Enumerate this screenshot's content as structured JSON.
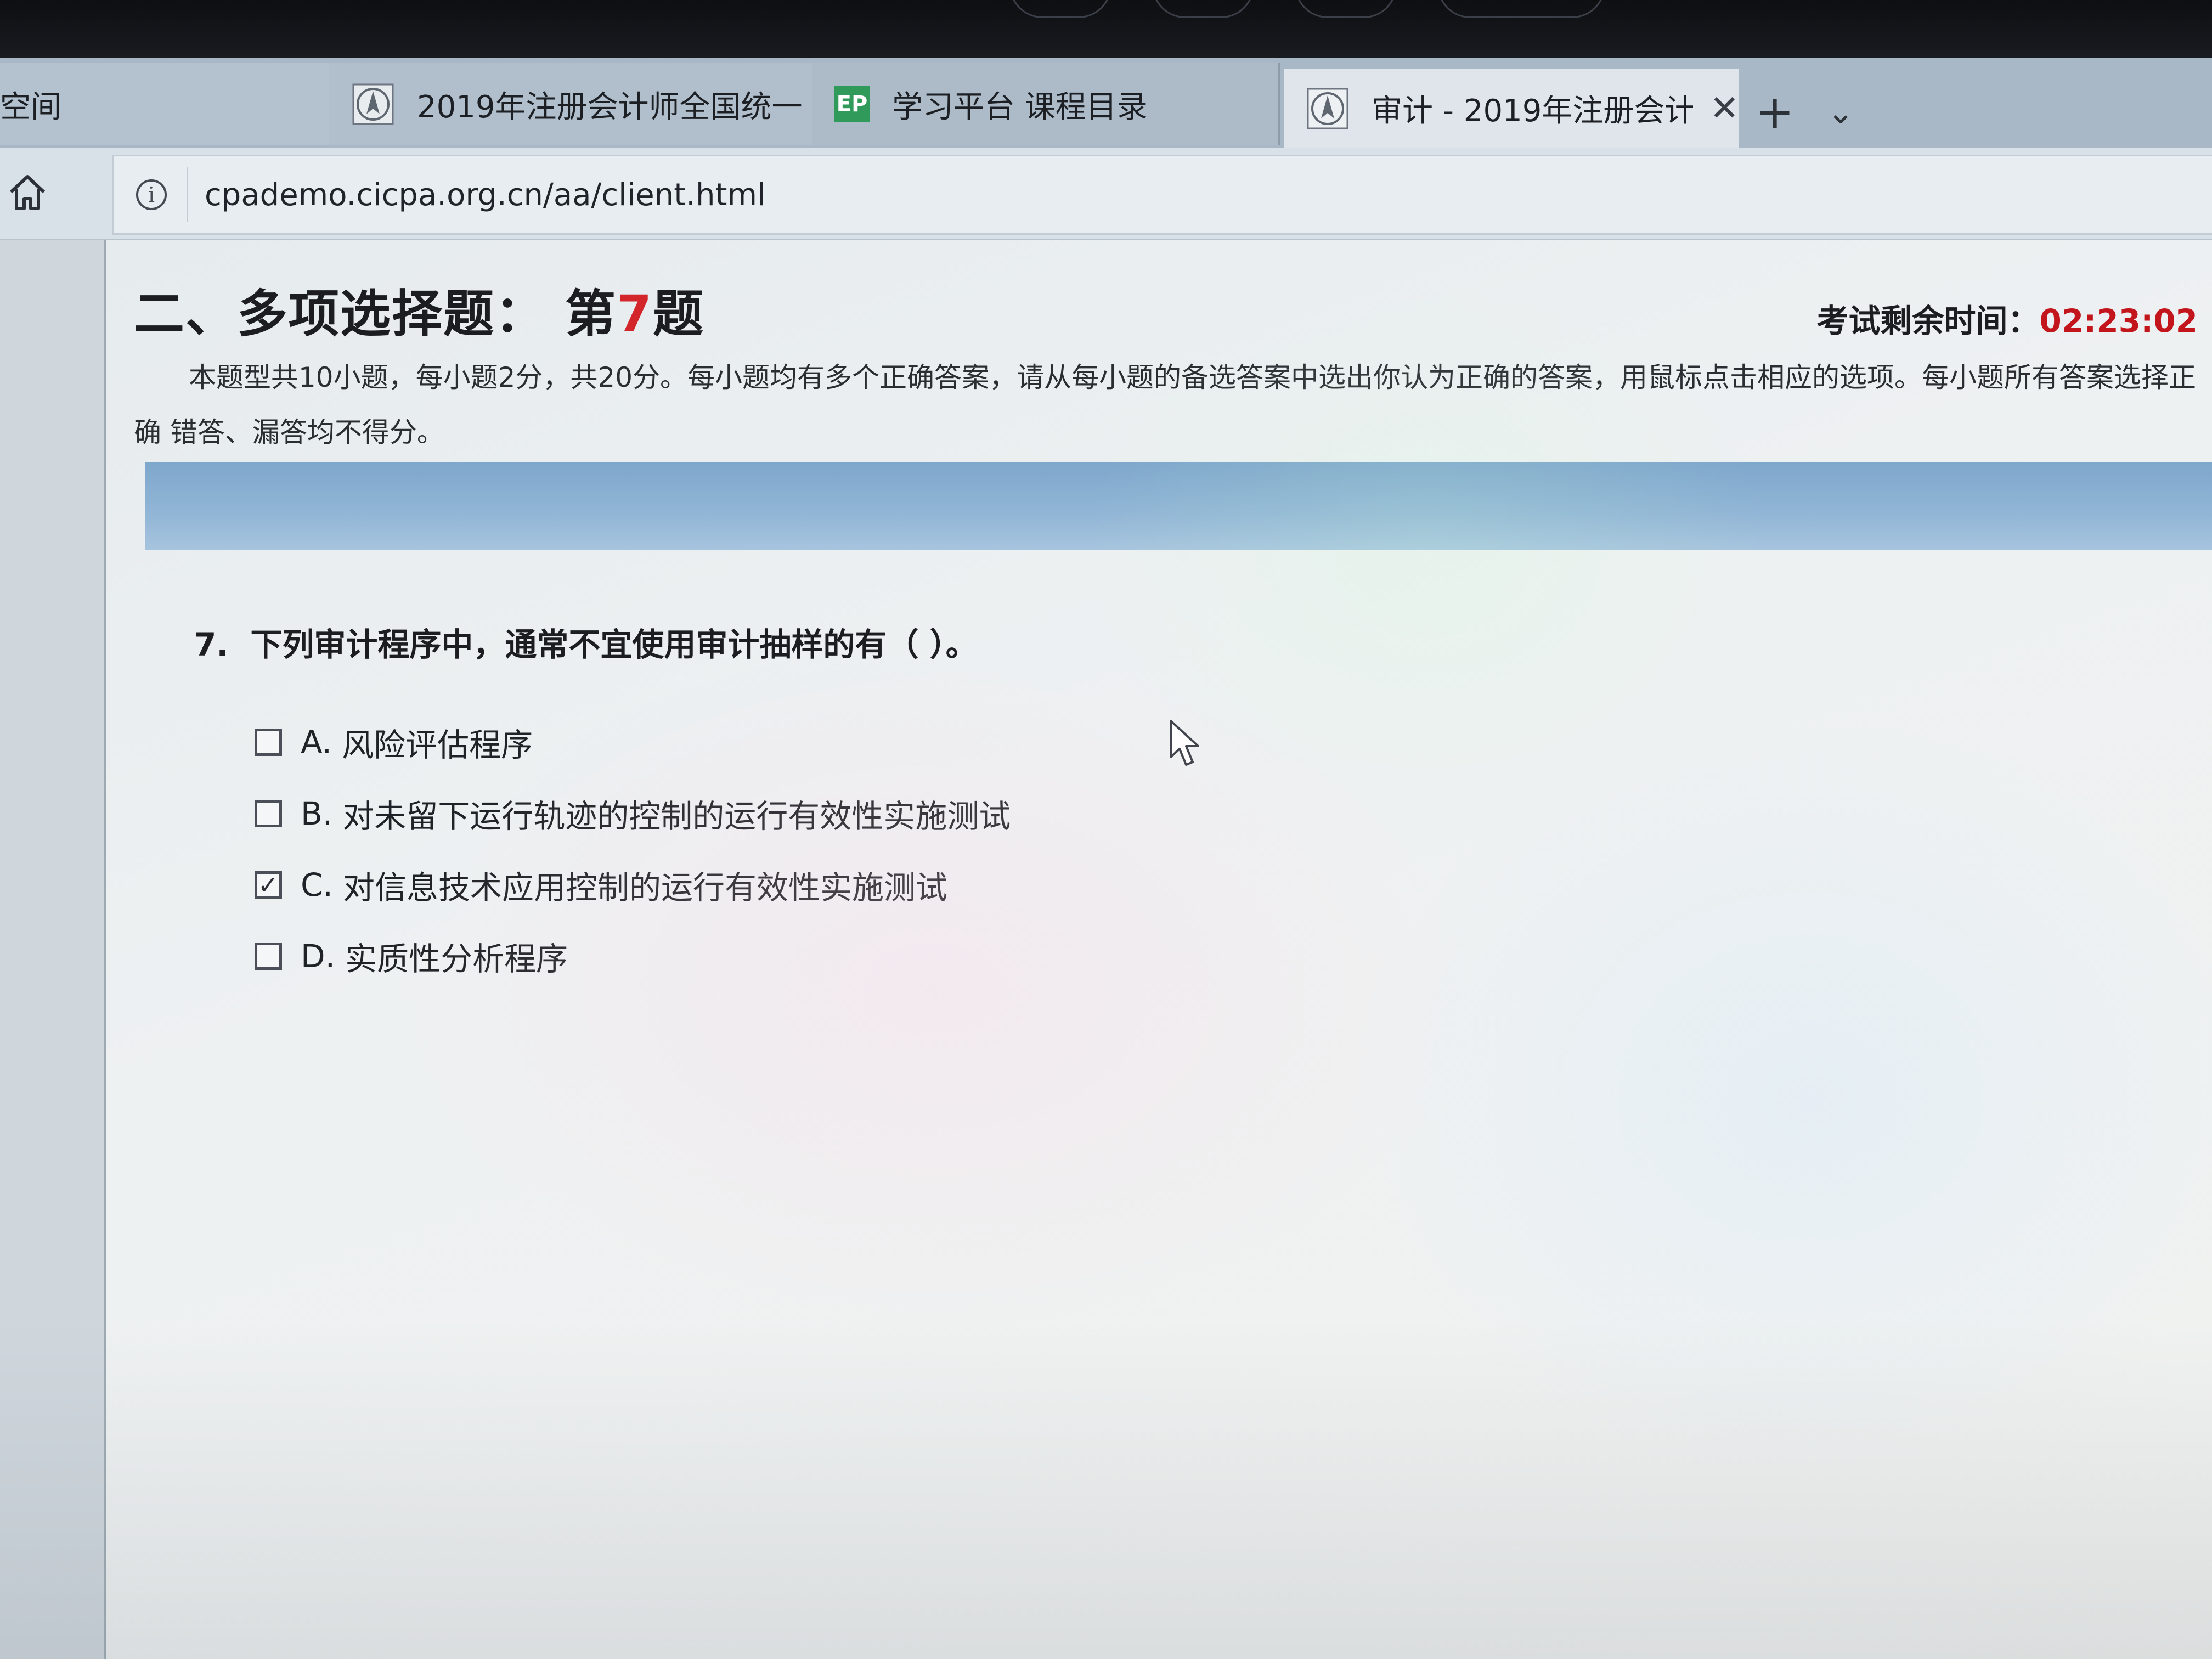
{
  "browser": {
    "tabs": [
      {
        "label": "空间",
        "icon": "none"
      },
      {
        "label": "2019年注册会计师全国统一",
        "icon": "cicpa-logo-icon"
      },
      {
        "label": "学习平台 课程目录",
        "icon": "ep-logo-icon",
        "icon_text": "EP"
      },
      {
        "label": "审计 - 2019年注册会计|",
        "icon": "cicpa-logo-icon",
        "active": true
      }
    ],
    "close_symbol": "✕",
    "new_tab_symbol": "+",
    "tab_menu_symbol": "⌄",
    "url": "cpademo.cicpa.org.cn/aa/client.html",
    "info_symbol": "i"
  },
  "exam": {
    "section_prefix": "二、多项选择题：  第",
    "question_number": "7",
    "section_suffix": "题",
    "timer_label": "考试剩余时间：",
    "timer_value": "02:23:02",
    "instructions": "本题型共10小题，每小题2分，共20分。每小题均有多个正确答案，请从每小题的备选答案中选出你认为正确的答案，用鼠标点击相应的选项。每小题所有答案选择正确 错答、漏答均不得分。",
    "question_index": "7.",
    "question_text": "下列审计程序中，通常不宜使用审计抽样的有（ ）。",
    "options": [
      {
        "letter": "A.",
        "text": "风险评估程序",
        "checked": false
      },
      {
        "letter": "B.",
        "text": "对未留下运行轨迹的控制的运行有效性实施测试",
        "checked": false
      },
      {
        "letter": "C.",
        "text": "对信息技术应用控制的运行有效性实施测试",
        "checked": true
      },
      {
        "letter": "D.",
        "text": "实质性分析程序",
        "checked": false
      }
    ],
    "check_mark": "✓"
  },
  "colors": {
    "accent_red": "#d2262a",
    "timer_red": "#c3161c",
    "band_blue": "#92b6d6",
    "ep_green": "#2f9a5a"
  }
}
